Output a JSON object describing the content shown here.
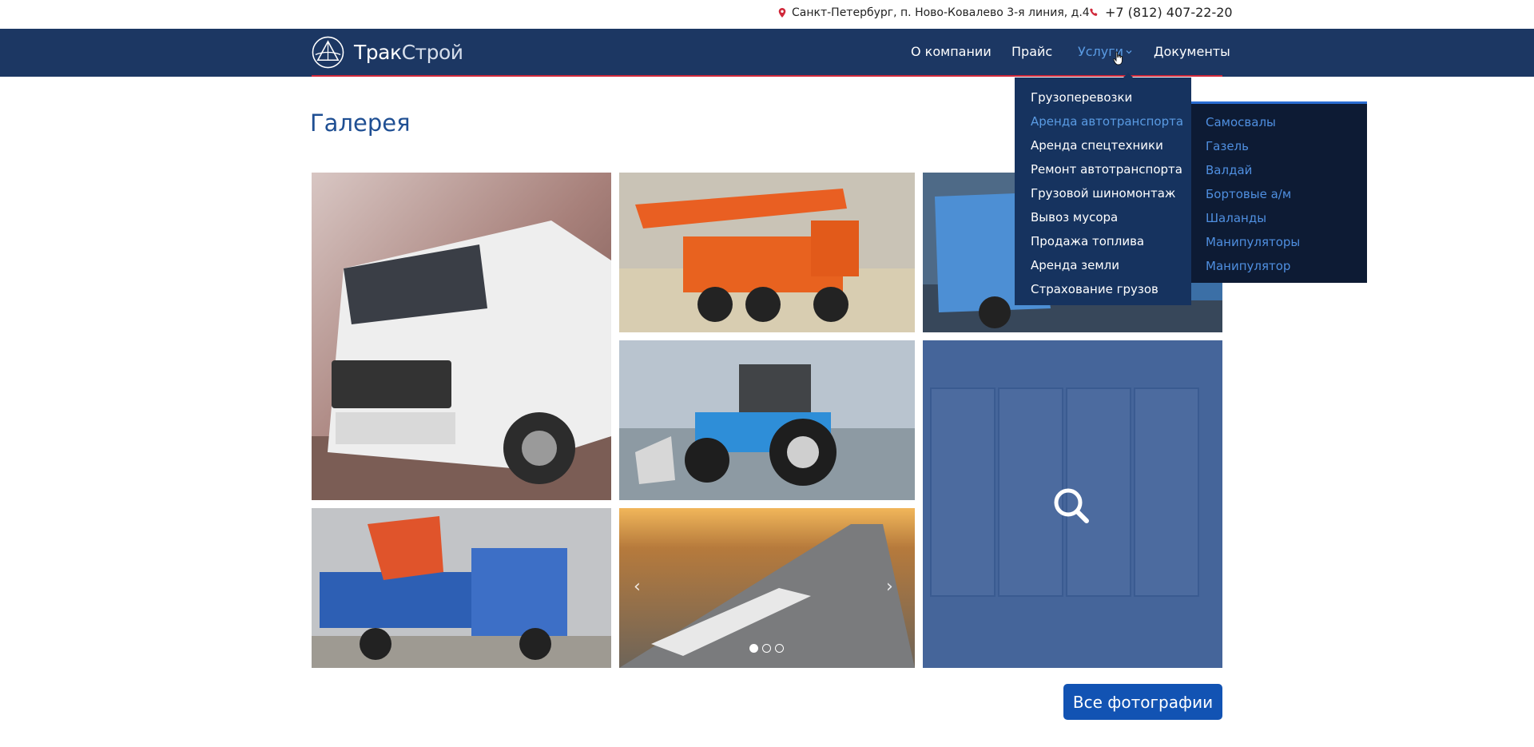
{
  "topbar": {
    "address": "Санкт-Петербург, п. Ново-Ковалево 3-я линия, д.4",
    "phone": "+7 (812) 407-22-20"
  },
  "logo": {
    "part1": "Трак",
    "part2": "Строй"
  },
  "nav": {
    "about": "О компании",
    "price": "Прайс",
    "services": "Услуги",
    "documents": "Документы"
  },
  "page": {
    "title": "Галерея"
  },
  "dropdown": {
    "items": [
      "Грузоперевозки",
      "Аренда автотранспорта",
      "Аренда спецтехники",
      "Ремонт автотранспорта",
      "Грузовой шиномонтаж",
      "Вывоз мусора",
      "Продажа топлива",
      "Аренда земли",
      "Страхование грузов"
    ]
  },
  "submenu": {
    "items": [
      "Самосвалы",
      "Газель",
      "Валдай",
      "Бортовые а/м",
      "Шаланды",
      "Манипуляторы",
      "Манипулятор"
    ]
  },
  "gallery": {
    "slider_prev": "‹",
    "slider_next": "›"
  },
  "buttons": {
    "all_photos": "Все фотографии"
  },
  "colors": {
    "navbar": "#1c3763",
    "accent_red": "#d0283a",
    "link_blue": "#5a9be3",
    "button_blue": "#1253b3",
    "title_blue": "#1f4f93"
  }
}
